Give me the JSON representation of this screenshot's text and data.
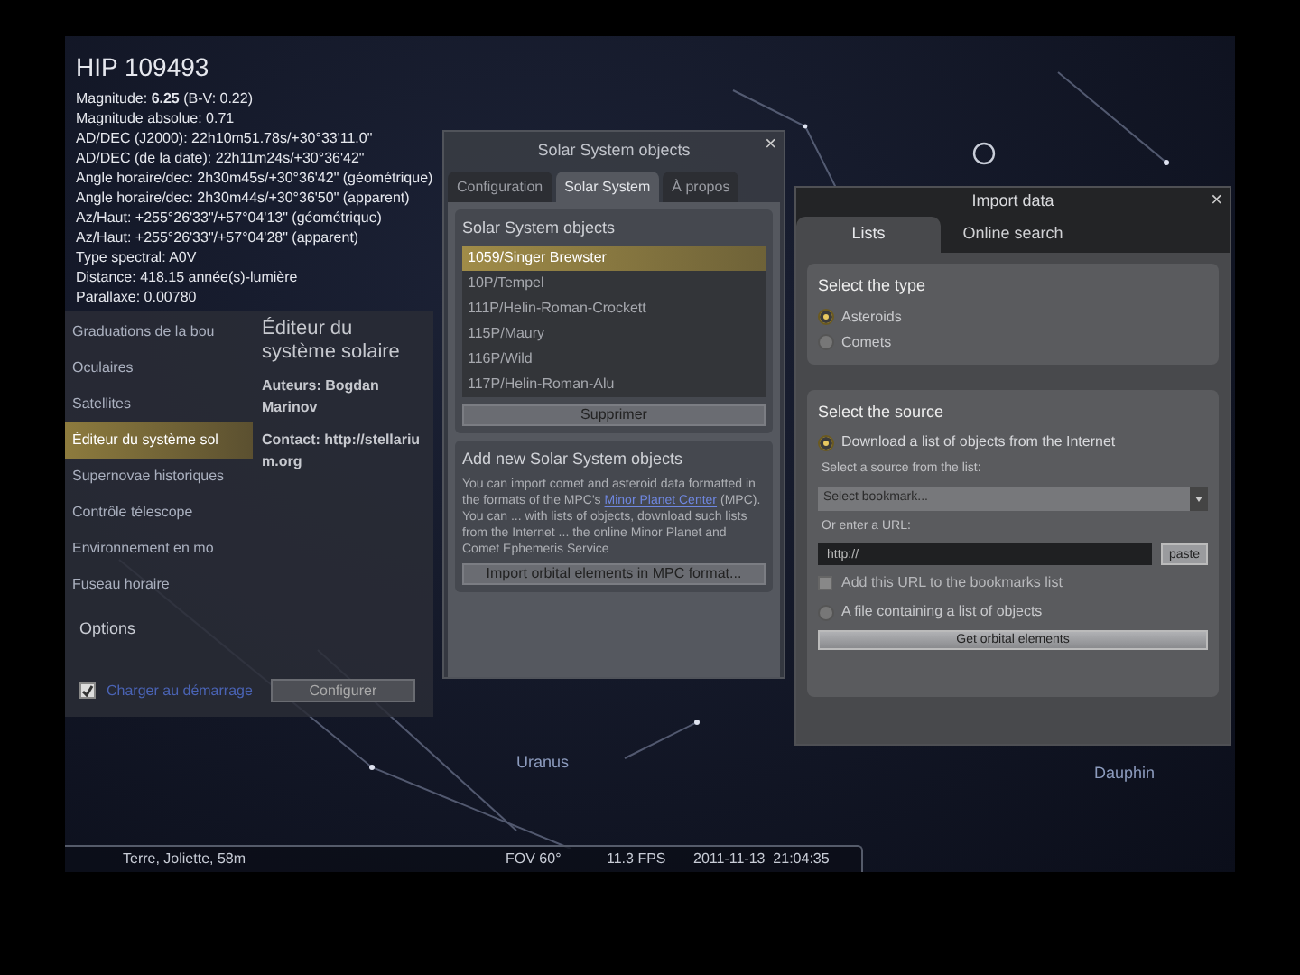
{
  "star_info": {
    "title": "HIP 109493",
    "lines": [
      "Magnitude: **6.25** (B-V: 0.22)",
      "Magnitude absolue: 0.71",
      "AD/DEC (J2000): 22h10m51.78s/+30°33'11.0\"",
      "AD/DEC (de la date): 22h11m24s/+30°36'42\"",
      "Angle horaire/dec: 2h30m45s/+30°36'42\" (géométrique)",
      "Angle horaire/dec: 2h30m44s/+30°36'50\" (apparent)",
      "Az/Haut: +255°26'33\"/+57°04'13\" (géométrique)",
      "Az/Haut: +255°26'33\"/+57°04'28\" (apparent)",
      "Type spectral: A0V",
      "Distance: 418.15 année(s)-lumière",
      "Parallaxe: 0.00780"
    ]
  },
  "sky_labels": [
    "Uranus",
    "Dauphin"
  ],
  "plugins_window": {
    "sidebar": [
      {
        "label": "Graduations de la bou",
        "selected": false
      },
      {
        "label": "Oculaires",
        "selected": false
      },
      {
        "label": "Satellites",
        "selected": false
      },
      {
        "label": "Éditeur du système sol",
        "selected": true
      },
      {
        "label": "Supernovae historiques",
        "selected": false
      },
      {
        "label": "Contrôle télescope",
        "selected": false
      },
      {
        "label": "Environnement en mo",
        "selected": false
      },
      {
        "label": "Fuseau horaire",
        "selected": false
      }
    ],
    "plugin": {
      "title": "Éditeur du système solaire",
      "authors": "Auteurs: Bogdan Marinov",
      "contact": "Contact: http://stellarium.org"
    },
    "options": {
      "label": "Options",
      "load_at_startup": {
        "label": "Charger au démarrage",
        "checked": true
      },
      "configure_button": "Configurer"
    }
  },
  "solar_window": {
    "title": "Solar System objects",
    "close": "×",
    "tabs": [
      {
        "label": "Configuration",
        "selected": false
      },
      {
        "label": "Solar System",
        "selected": true
      },
      {
        "label": "À propos",
        "selected": false
      }
    ],
    "objects_section": {
      "title": "Solar System objects",
      "items": [
        {
          "label": "1059/Singer Brewster",
          "selected": true
        },
        {
          "label": "10P/Tempel",
          "selected": false
        },
        {
          "label": "111P/Helin-Roman-Crockett",
          "selected": false
        },
        {
          "label": "115P/Maury",
          "selected": false
        },
        {
          "label": "116P/Wild",
          "selected": false
        },
        {
          "label": "117P/Helin-Roman-Alu",
          "selected": false
        }
      ],
      "remove_button": "Supprimer"
    },
    "add_section": {
      "title": "Add new Solar System objects",
      "text_before": "You can import comet and asteroid data formatted in the formats of the MPC's",
      "link": "Minor Planet Center",
      "text_after": "(MPC). You can ... with lists of objects, download such lists from the Internet ... the online Minor Planet and Comet Ephemeris Service",
      "import_button": "Import orbital elements in MPC format..."
    }
  },
  "import_window": {
    "title": "Import data",
    "close": "×",
    "tabs": [
      {
        "label": "Lists",
        "selected": true
      },
      {
        "label": "Online search",
        "selected": false
      }
    ],
    "type_group": {
      "title": "Select the type",
      "options": [
        {
          "label": "Asteroids",
          "selected": true
        },
        {
          "label": "Comets",
          "selected": false
        }
      ]
    },
    "source_group": {
      "title": "Select the source",
      "download": {
        "label": "Download a list of objects from the Internet",
        "selected": true
      },
      "list_label": "Select a source from the list:",
      "bookmark_select": "Select bookmark...",
      "url_label": "Or enter a URL:",
      "url_value": "http://",
      "paste_button": "paste",
      "bookmark_checkbox": {
        "label": "Add this URL to the bookmarks list",
        "checked": false
      },
      "file": {
        "label": "A file containing a list of objects",
        "selected": false
      },
      "get_button": "Get orbital elements"
    }
  },
  "status_bar": {
    "location": "Terre, Joliette, 58m",
    "fov": "FOV 60°",
    "fps": "11.3 FPS",
    "datetime": "2011-11-13  21:04:35"
  }
}
